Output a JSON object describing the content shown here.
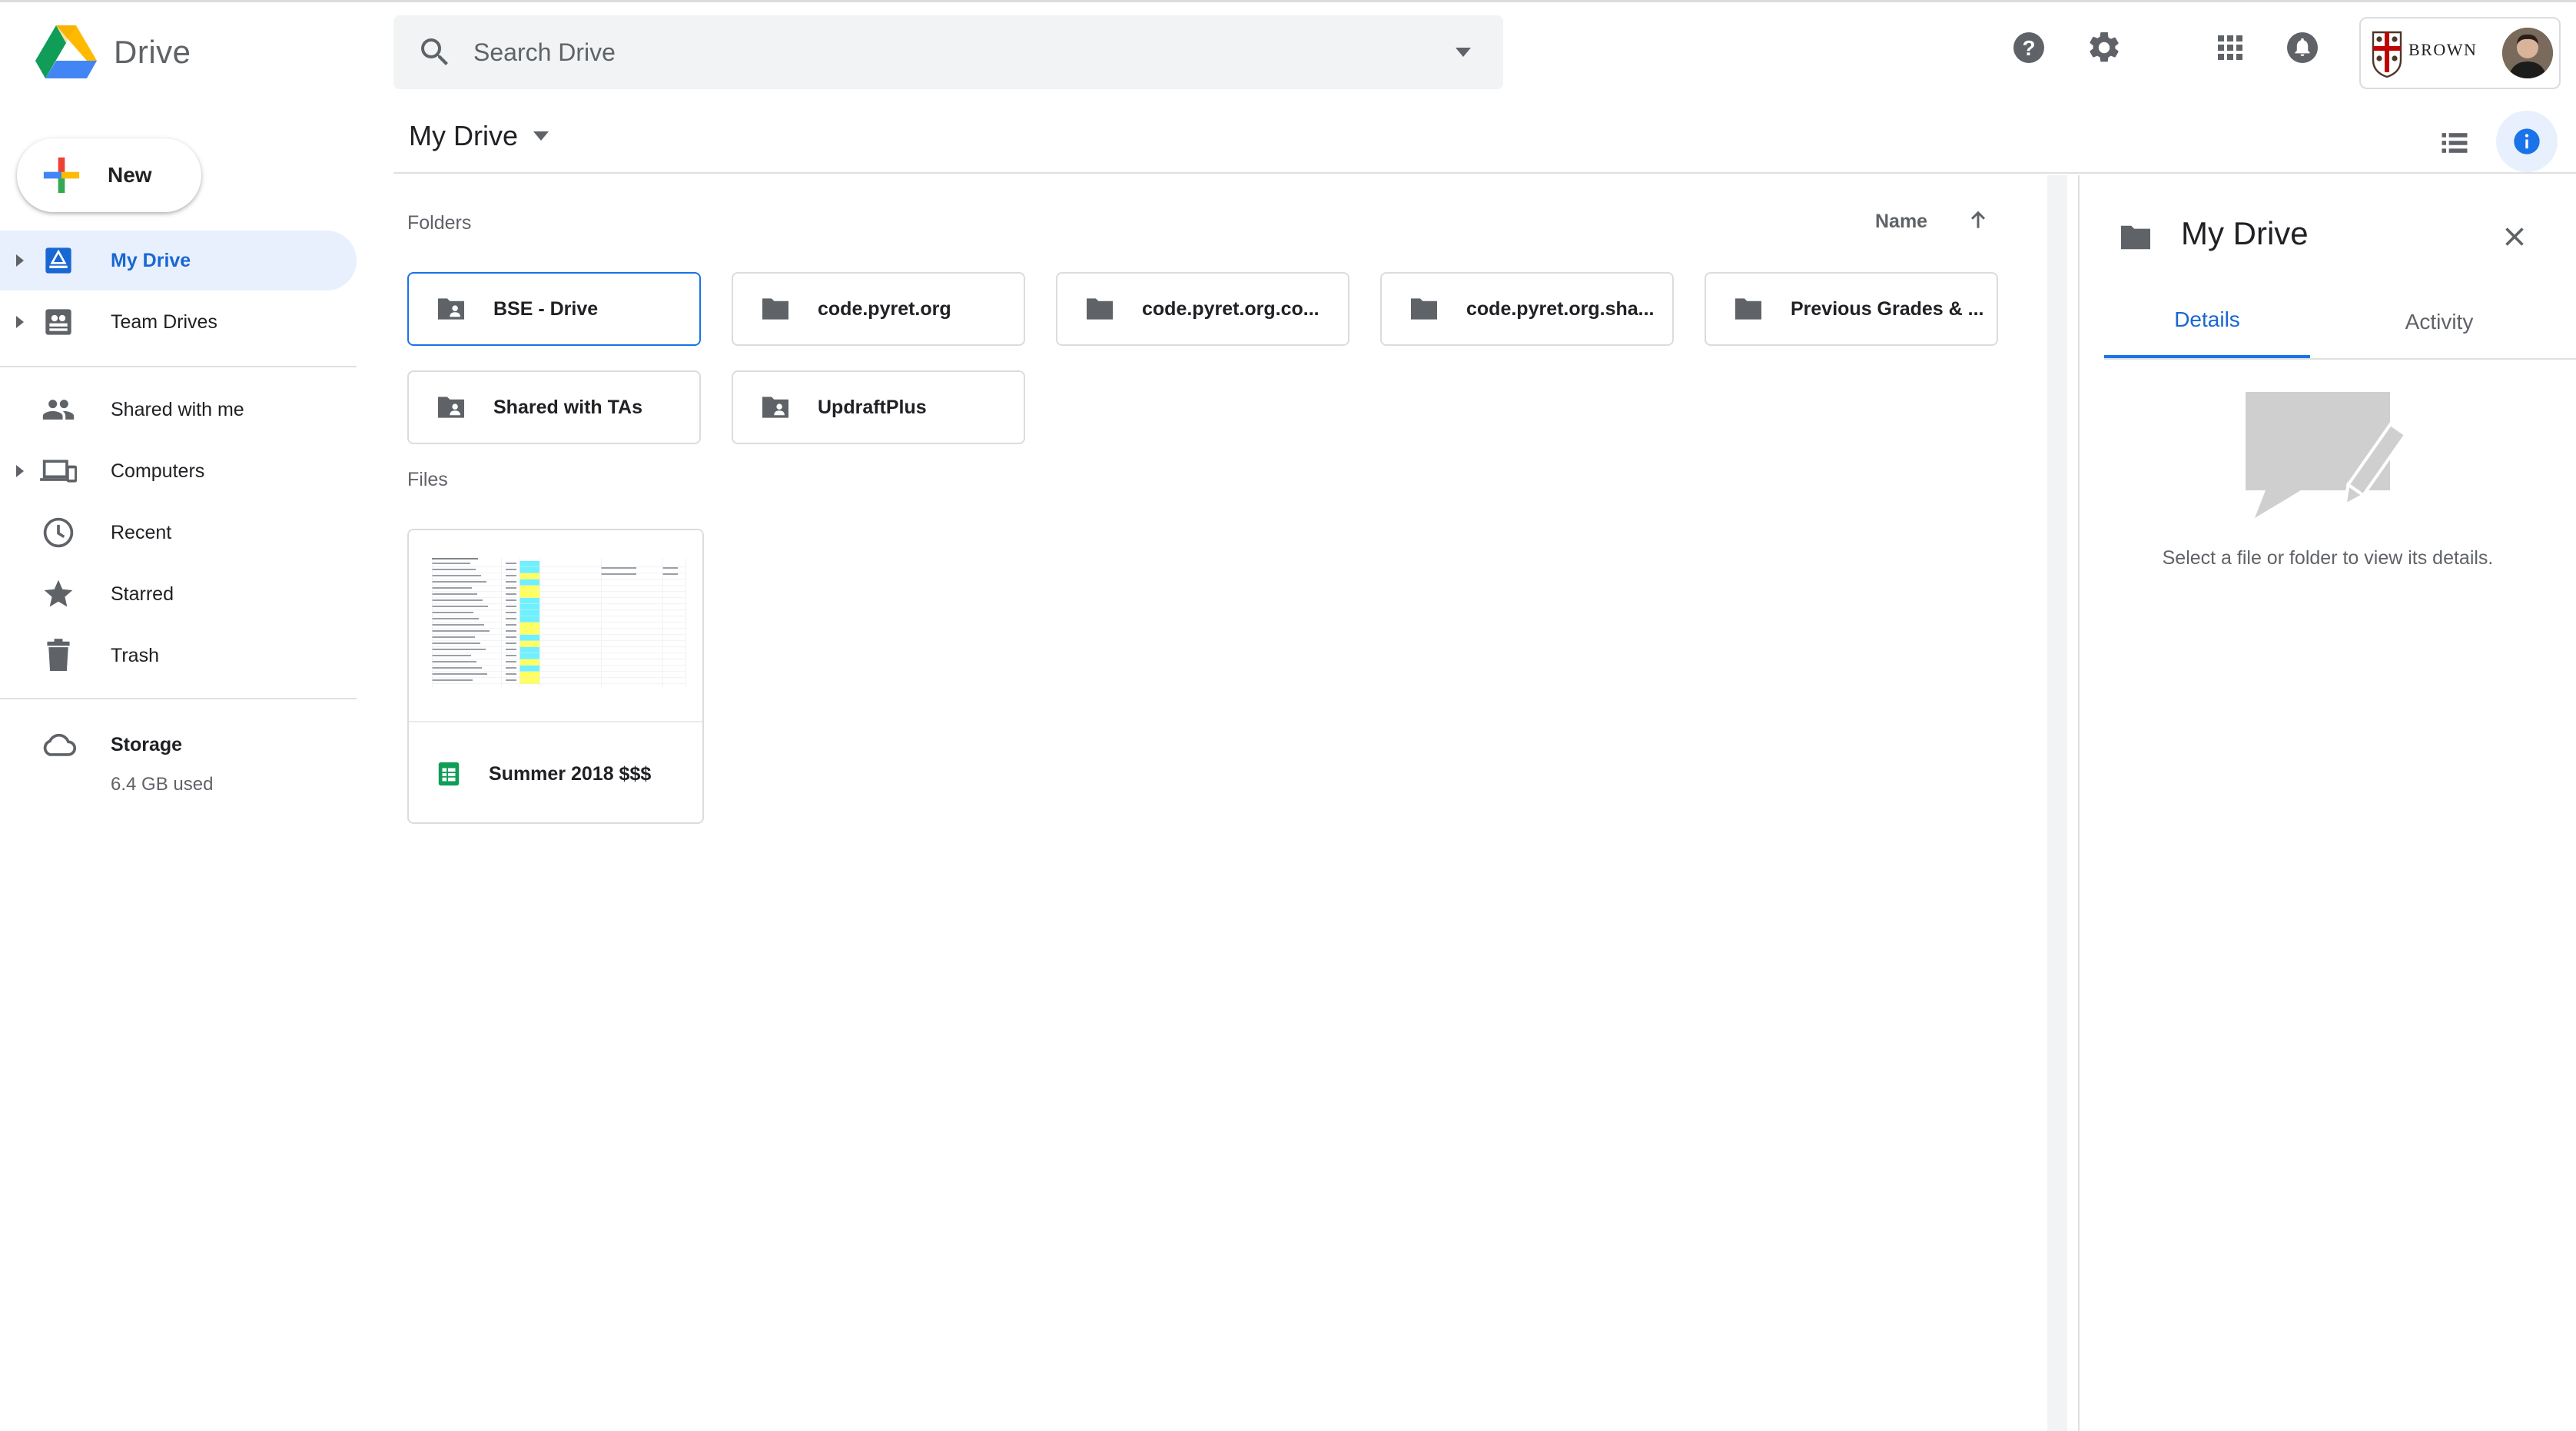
{
  "header": {
    "app_title": "Drive",
    "search_placeholder": "Search Drive",
    "account_label": "BROWN"
  },
  "toolbar": {
    "breadcrumb": "My Drive"
  },
  "sidebar": {
    "new_label": "New",
    "items": [
      {
        "label": "My Drive",
        "icon": "my-drive-icon",
        "active": true
      },
      {
        "label": "Team Drives",
        "icon": "team-drives-icon"
      },
      {
        "label": "Shared with me",
        "icon": "people-icon"
      },
      {
        "label": "Computers",
        "icon": "computers-icon"
      },
      {
        "label": "Recent",
        "icon": "clock-icon"
      },
      {
        "label": "Starred",
        "icon": "star-icon"
      },
      {
        "label": "Trash",
        "icon": "trash-icon"
      }
    ],
    "storage": {
      "label": "Storage",
      "used": "6.4 GB used"
    }
  },
  "main": {
    "folders_label": "Folders",
    "files_label": "Files",
    "sort_label": "Name",
    "folders": [
      {
        "name": "BSE - Drive",
        "shared": true,
        "selected": true
      },
      {
        "name": "code.pyret.org",
        "shared": false
      },
      {
        "name": "code.pyret.org.co...",
        "shared": false
      },
      {
        "name": "code.pyret.org.sha...",
        "shared": false
      },
      {
        "name": "Previous Grades & ...",
        "shared": false
      },
      {
        "name": "Shared with TAs",
        "shared": true
      },
      {
        "name": "UpdraftPlus",
        "shared": true
      }
    ],
    "files": [
      {
        "name": "Summer 2018 $$$",
        "type": "sheets-icon"
      }
    ]
  },
  "details": {
    "title": "My Drive",
    "tabs": [
      "Details",
      "Activity"
    ],
    "empty_message": "Select a file or folder to view its details."
  },
  "colors": {
    "accent": "#1a73e8",
    "active_bg": "#e8f0fe",
    "icon_gray": "#5f6368",
    "sheets_green": "#0f9d58"
  }
}
